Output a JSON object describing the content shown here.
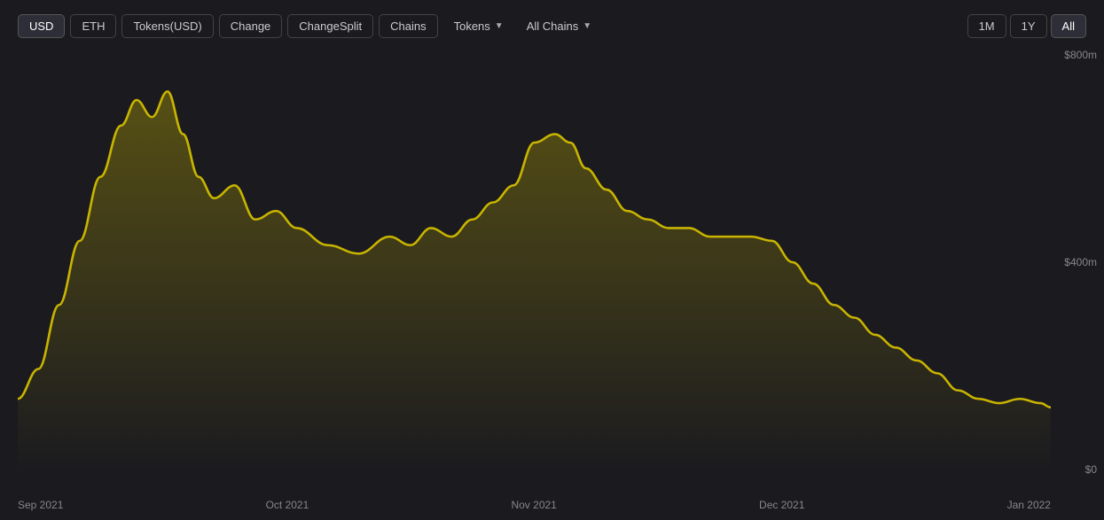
{
  "toolbar": {
    "buttons": [
      {
        "label": "USD",
        "active": true,
        "id": "usd"
      },
      {
        "label": "ETH",
        "active": false,
        "id": "eth"
      },
      {
        "label": "Tokens(USD)",
        "active": false,
        "id": "tokens-usd"
      },
      {
        "label": "Change",
        "active": false,
        "id": "change"
      },
      {
        "label": "ChangeSplit",
        "active": false,
        "id": "change-split"
      },
      {
        "label": "Chains",
        "active": false,
        "id": "chains"
      }
    ],
    "dropdowns": [
      {
        "label": "Tokens",
        "id": "tokens-dropdown"
      },
      {
        "label": "All Chains",
        "id": "all-chains-dropdown"
      }
    ],
    "time_buttons": [
      {
        "label": "1M",
        "active": false,
        "id": "1m"
      },
      {
        "label": "1Y",
        "active": false,
        "id": "1y"
      },
      {
        "label": "All",
        "active": true,
        "id": "all"
      }
    ]
  },
  "chart": {
    "y_labels": [
      "$800m",
      "$400m",
      "$0"
    ],
    "x_labels": [
      "Sep 2021",
      "Oct 2021",
      "Nov 2021",
      "Dec 2021",
      "Jan 2022"
    ],
    "accent_color": "#c8b400",
    "fill_color_top": "rgba(180,160,0,0.3)",
    "fill_color_bottom": "rgba(180,160,0,0.0)"
  }
}
